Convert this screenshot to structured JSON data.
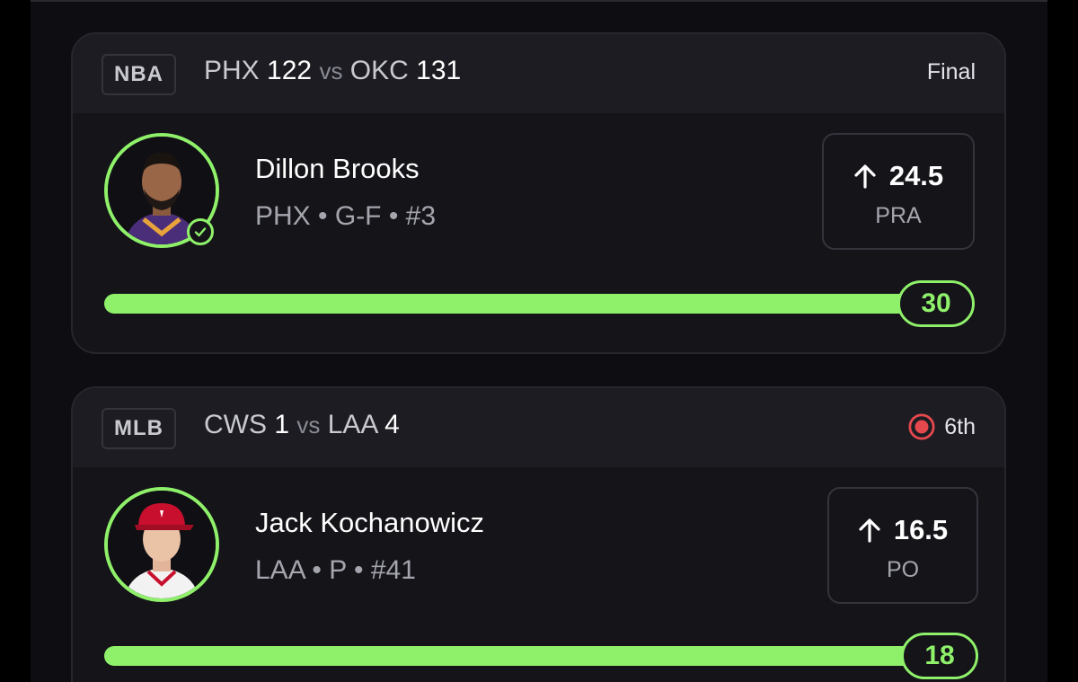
{
  "colors": {
    "accent": "#8ff06a",
    "live": "#e5484d",
    "background": "#0e0e12",
    "card": "#141419",
    "header": "#1c1c22"
  },
  "cards": [
    {
      "league": "NBA",
      "home_team": "PHX",
      "home_score": "122",
      "vs": "vs",
      "away_team": "OKC",
      "away_score": "131",
      "status": "Final",
      "status_icon": "",
      "player": {
        "name": "Dillon Brooks",
        "meta": "PHX • G-F • #3",
        "avatar_icon": "player-headshot",
        "verified_icon": "check-circle-icon"
      },
      "line": {
        "direction_icon": "arrow-up-icon",
        "value": "24.5",
        "stat": "PRA"
      },
      "progress": {
        "actual": "30",
        "fill_fraction": 1.0
      }
    },
    {
      "league": "MLB",
      "home_team": "CWS",
      "home_score": "1",
      "vs": "vs",
      "away_team": "LAA",
      "away_score": "4",
      "status": "6th",
      "status_icon": "live-dot-icon",
      "player": {
        "name": "Jack Kochanowicz",
        "meta": "LAA • P • #41",
        "avatar_icon": "player-headshot"
      },
      "line": {
        "direction_icon": "arrow-up-icon",
        "value": "16.5",
        "stat": "PO"
      },
      "progress": {
        "actual": "18",
        "fill_fraction": 1.0
      }
    }
  ]
}
